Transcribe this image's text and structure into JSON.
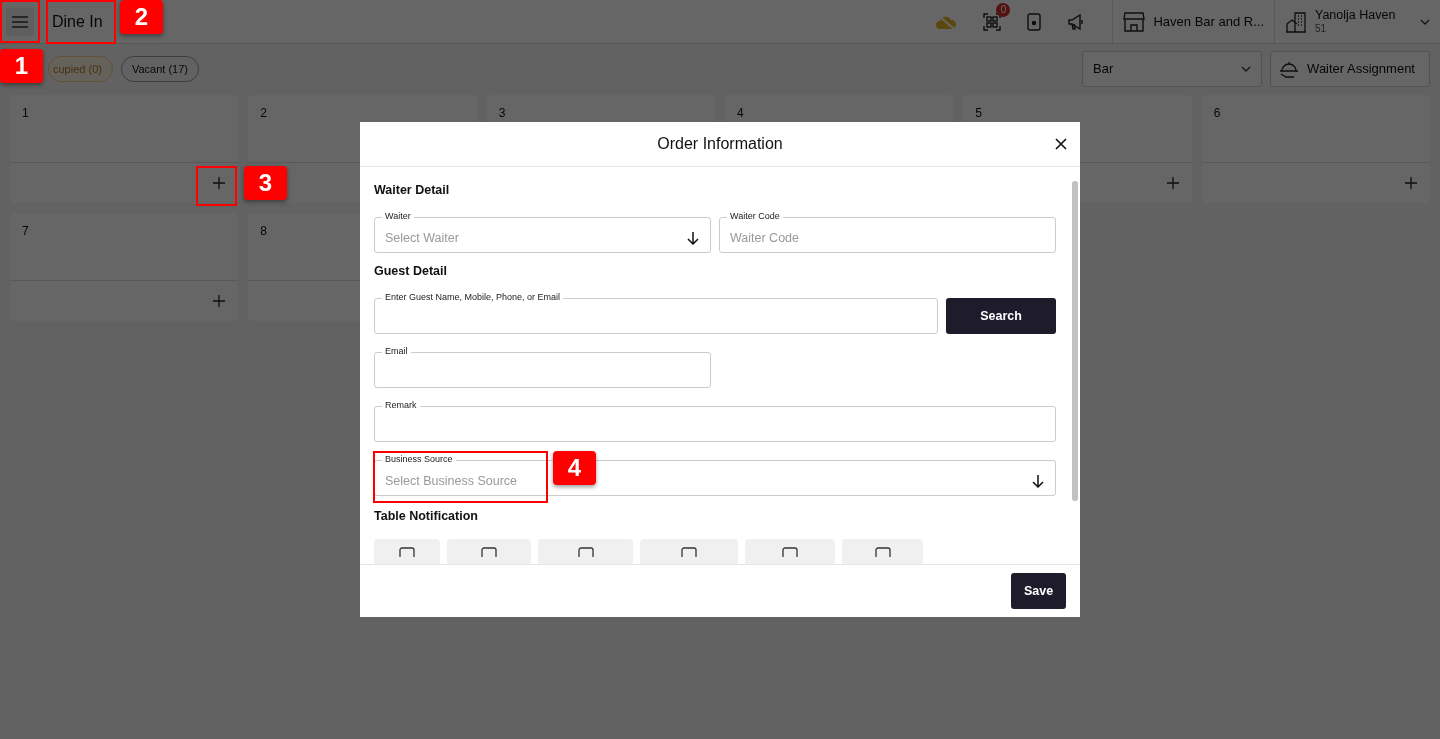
{
  "header": {
    "title": "Dine In",
    "qr_badge": "0",
    "outlet": "Haven Bar and R...",
    "property_name": "Yanolja Haven",
    "property_code": "51"
  },
  "filters": {
    "chips": [
      {
        "label": "cupied (0)",
        "kind": "occupied"
      },
      {
        "label": "Vacant (17)",
        "kind": "vacant"
      }
    ],
    "area": "Bar",
    "waiter_button": "Waiter Assignment"
  },
  "tables": [
    {
      "number": "1",
      "add": true
    },
    {
      "number": "2",
      "add": false
    },
    {
      "number": "3",
      "add": false
    },
    {
      "number": "4",
      "add": false
    },
    {
      "number": "5",
      "add": true
    },
    {
      "number": "6",
      "add": true
    },
    {
      "number": "7",
      "add": true
    },
    {
      "number": "8",
      "add": false
    }
  ],
  "modal": {
    "title": "Order Information",
    "waiter_heading": "Waiter Detail",
    "waiter": {
      "label": "Waiter",
      "placeholder": "Select Waiter"
    },
    "waiter_code": {
      "label": "Waiter Code",
      "placeholder": "Waiter Code"
    },
    "guest_heading": "Guest Detail",
    "guest": {
      "label": "Enter Guest Name, Mobile, Phone, or Email"
    },
    "search_button": "Search",
    "email": {
      "label": "Email"
    },
    "remark": {
      "label": "Remark"
    },
    "business_source": {
      "label": "Business Source",
      "placeholder": "Select Business Source"
    },
    "notification_heading": "Table Notification",
    "save_button": "Save"
  },
  "annotations": [
    "1",
    "2",
    "3",
    "4"
  ]
}
